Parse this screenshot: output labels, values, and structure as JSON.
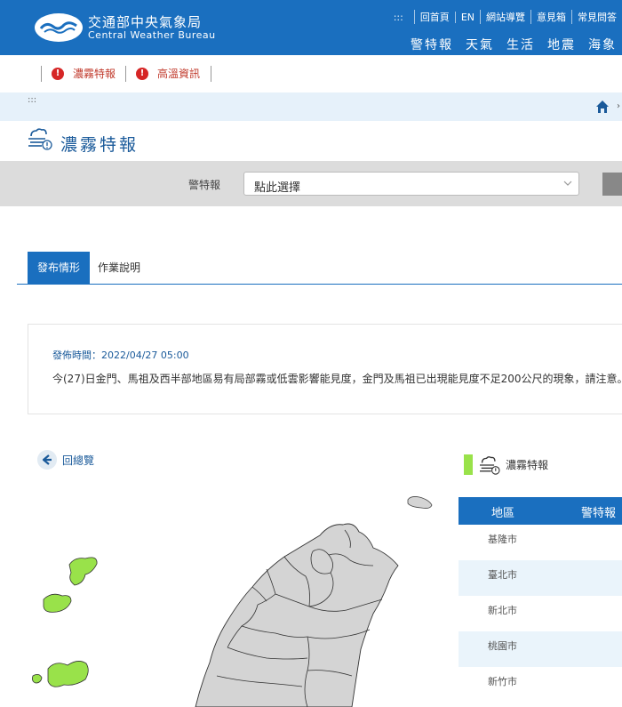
{
  "header": {
    "brand_zh": "交通部中央氣象局",
    "brand_en": "Central Weather Bureau",
    "top_links": [
      "回首頁",
      "EN",
      "網站導覽",
      "意見箱",
      "常見問答"
    ],
    "dots": ":::",
    "main_nav": [
      "警特報",
      "天氣",
      "生活",
      "地震",
      "海象"
    ]
  },
  "alerts": [
    "濃霧特報",
    "高溫資訊"
  ],
  "breadcrumb": {
    "dots": ":::"
  },
  "page_title": "濃霧特報",
  "selector": {
    "label": "警特報",
    "value": "點此選擇"
  },
  "tabs": [
    "發布情形",
    "作業說明"
  ],
  "notice": {
    "time": "發佈時間：2022/04/27 05:00",
    "text": "今(27)日金門、馬祖及西半部地區易有局部霧或低雲影響能見度，金門及馬祖已出現能見度不足200公尺的現象，請注意。"
  },
  "back_label": "回總覽",
  "legend": {
    "label": "濃霧特報",
    "color": "#99e24a"
  },
  "table": {
    "headers": [
      "地區",
      "警特報"
    ],
    "rows": [
      "基隆市",
      "臺北市",
      "新北市",
      "桃園市",
      "新竹市"
    ]
  },
  "colors": {
    "brand_blue": "#1a6fbf",
    "alert_red": "#d62626",
    "fog_green": "#99e24a"
  }
}
